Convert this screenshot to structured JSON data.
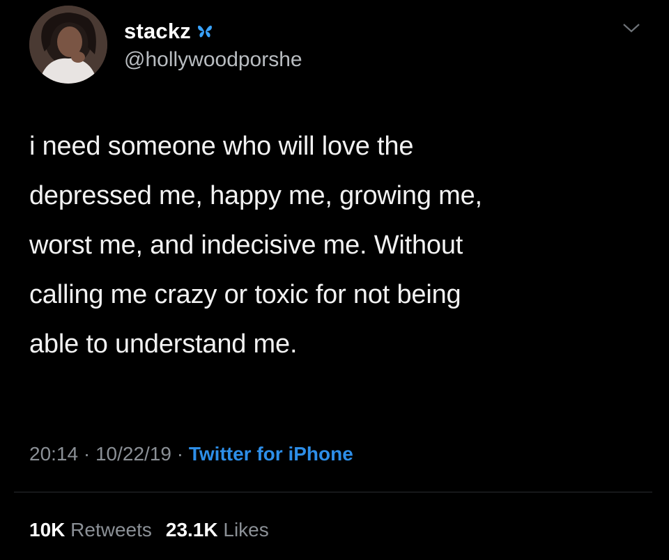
{
  "user": {
    "display_name": "stackz",
    "handle": "@hollywoodporshe",
    "verified_emoji_icon": "butterfly-icon"
  },
  "tweet": {
    "text": "i need someone who will love the\ndepressed me, happy me, growing me,\nworst me, and indecisive me. Without\ncalling me crazy or toxic for not being\nable to understand me."
  },
  "meta": {
    "time": "20:14",
    "separator": " · ",
    "date": "10/22/19",
    "source": "Twitter for iPhone"
  },
  "stats": {
    "retweets_count": "10K",
    "retweets_label": "Retweets",
    "likes_count": "23.1K",
    "likes_label": "Likes"
  },
  "colors": {
    "background": "#000000",
    "text": "#f2f2f2",
    "muted": "#8b9096",
    "link": "#2d8ee8",
    "butterfly": "#3aa3ff"
  }
}
